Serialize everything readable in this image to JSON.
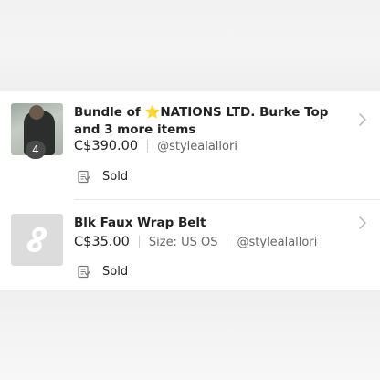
{
  "listings": [
    {
      "title_prefix": "Bundle of ",
      "star_icon": "star-icon",
      "title_rest": "NATIONS LTD.  Burke Top and 3 more items",
      "price": "C$390.00",
      "seller": "@stylealallori",
      "status": "Sold",
      "item_count": "4",
      "thumbnail": "photo"
    },
    {
      "title": "Blk Faux Wrap Belt",
      "price": "C$35.00",
      "size": "Size: US OS",
      "seller": "@stylealallori",
      "status": "Sold",
      "thumbnail": "placeholder-logo-icon"
    }
  ],
  "colors": {
    "placeholder_bg": "#dcdcdc",
    "text": "#222222",
    "muted": "#666666",
    "star": "#f5b700"
  }
}
